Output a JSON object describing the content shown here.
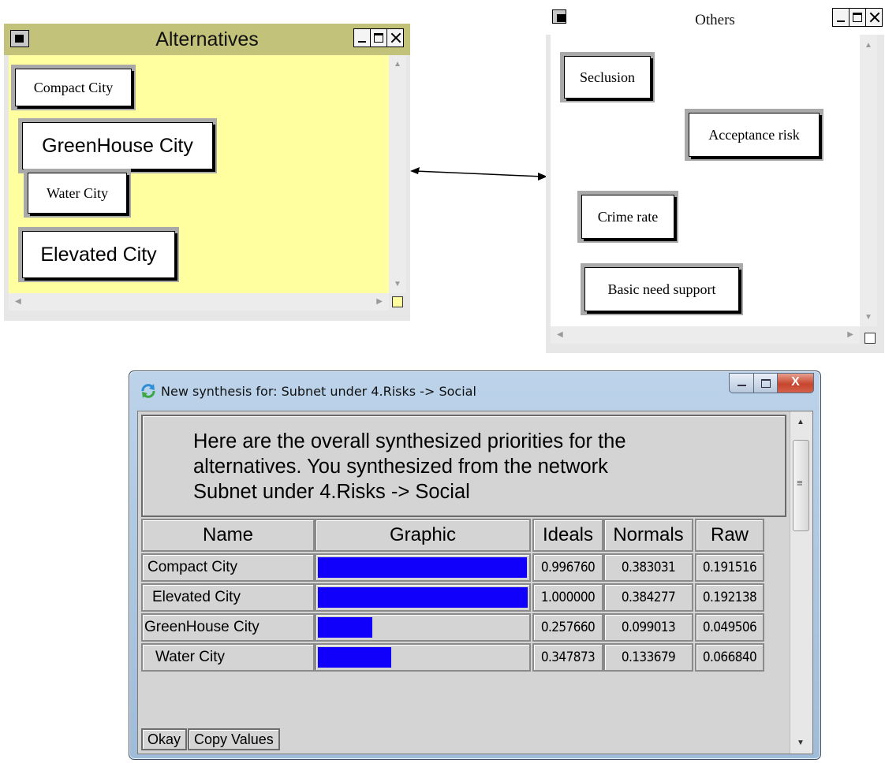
{
  "alternatives_cluster": {
    "title": "Alternatives",
    "nodes": [
      "Compact City",
      "GreenHouse City",
      "Water City",
      "Elevated City"
    ]
  },
  "others_cluster": {
    "title": "Others",
    "nodes": [
      "Seclusion",
      "Acceptance risk",
      "Crime rate",
      "Basic need support"
    ]
  },
  "colors": {
    "alternatives_bg": "#ffff9f",
    "alternatives_titlebar": "#c3c27a",
    "others_bg": "#ffffff",
    "bar": "#1000fb"
  },
  "synthesis_dialog": {
    "title": "New synthesis for: Subnet under 4.Risks -> Social",
    "message_lines": [
      "Here are the overall synthesized priorities for the",
      "alternatives.  You synthesized from the network",
      "Subnet under 4.Risks -> Social"
    ],
    "columns": [
      "Name",
      "Graphic",
      "Ideals",
      "Normals",
      "Raw"
    ],
    "rows": [
      {
        "name": "Compact City",
        "ideal": 0.99676,
        "ideals": "0.996760",
        "normals": "0.383031",
        "raw": "0.191516"
      },
      {
        "name": "Elevated City",
        "ideal": 1.0,
        "ideals": "1.000000",
        "normals": "0.384277",
        "raw": "0.192138"
      },
      {
        "name": "GreenHouse City",
        "ideal": 0.25766,
        "ideals": "0.257660",
        "normals": "0.099013",
        "raw": "0.049506"
      },
      {
        "name": "Water City",
        "ideal": 0.347873,
        "ideals": "0.347873",
        "normals": "0.133679",
        "raw": "0.066840"
      }
    ],
    "buttons": {
      "okay": "Okay",
      "copy_values": "Copy Values"
    }
  }
}
